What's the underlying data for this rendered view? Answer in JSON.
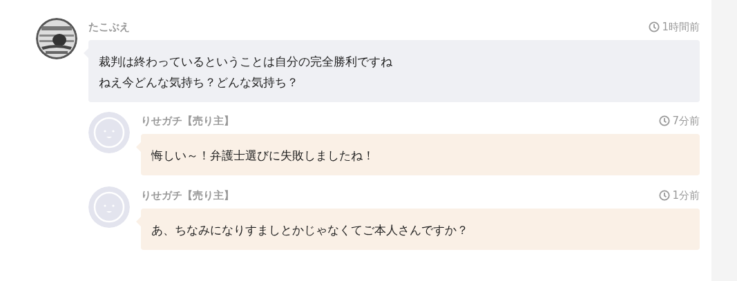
{
  "comments": [
    {
      "author": "たこぶえ",
      "time": "1時間前",
      "kind": "comment",
      "lines": [
        "裁判は終わっているということは自分の完全勝利ですね",
        "ねえ今どんな気持ち？どんな気持ち？"
      ],
      "children": [
        {
          "author": "りせガチ【売り主】",
          "time": "7分前",
          "avatar": {
            "kind": "default"
          },
          "kind": "reply",
          "lines": [
            "悔しい～！弁護士選びに失敗しましたね！"
          ]
        },
        {
          "author": "りせガチ【売り主】",
          "time": "1分前",
          "avatar": {
            "kind": "default"
          },
          "kind": "reply",
          "lines": [
            "あ、ちなみになりすましとかじゃなくてご本人さんですか？"
          ]
        }
      ]
    }
  ]
}
